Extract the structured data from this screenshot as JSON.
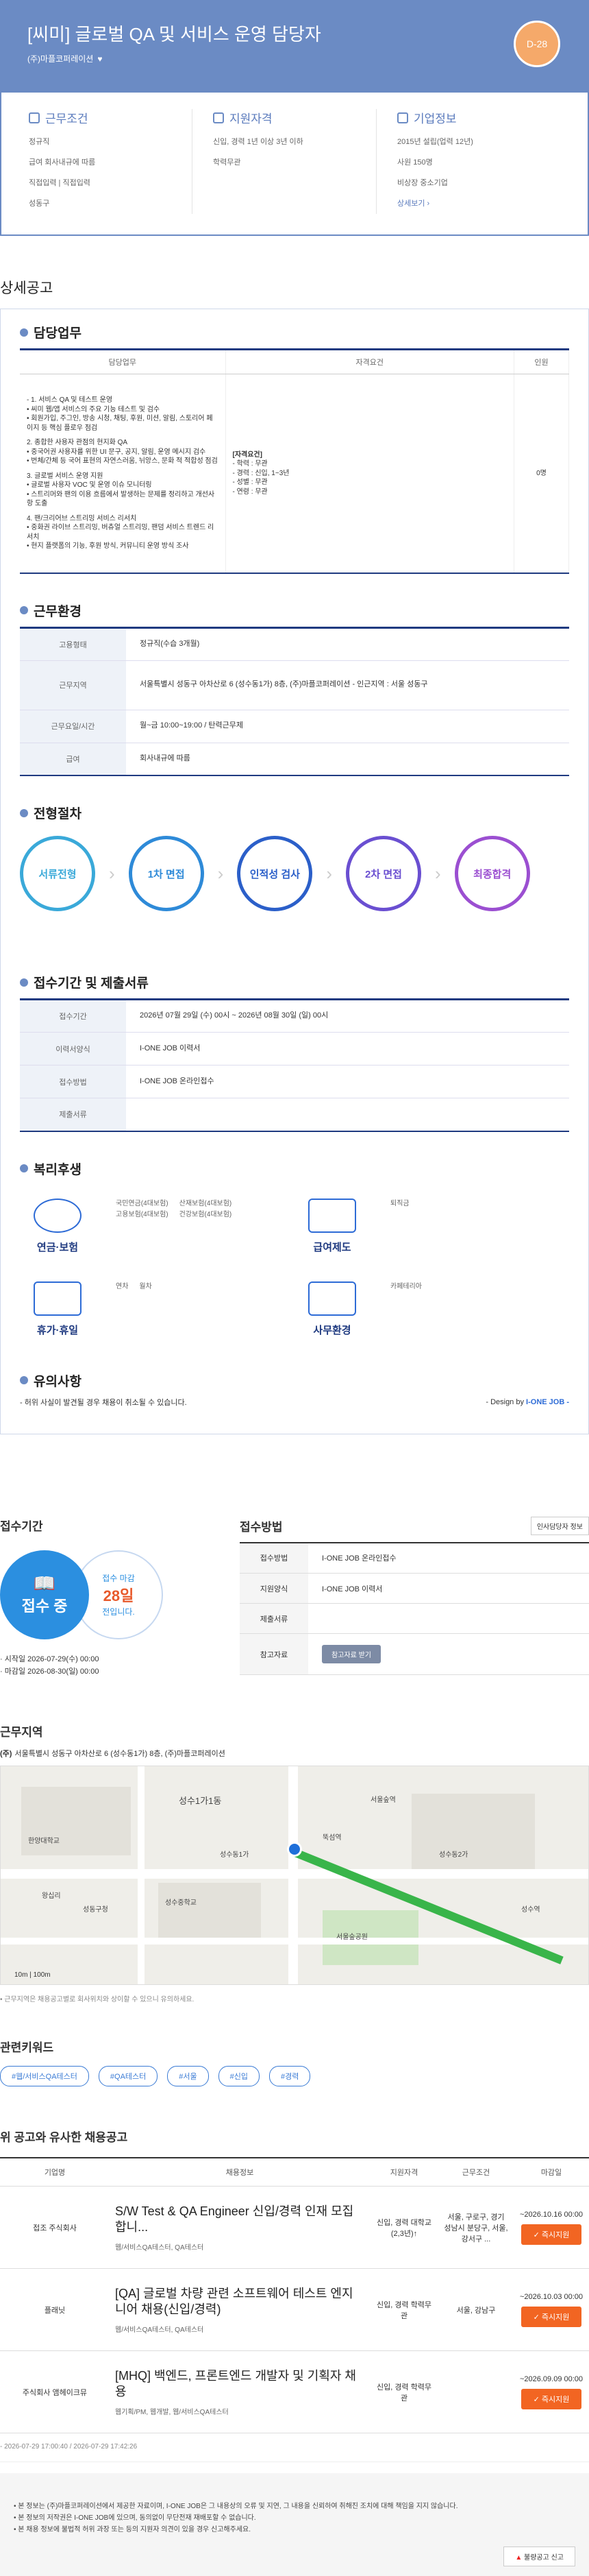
{
  "header": {
    "title": "[씨미] 글로벌 QA 및 서비스 운영 담당자",
    "company": "(주)마플코퍼레이션",
    "dday": "D-28"
  },
  "summary": {
    "conditions": {
      "title": "근무조건",
      "items": [
        "정규직",
        "급여 회사내규에 따름",
        "직접입력 | 직접입력",
        "성동구"
      ]
    },
    "qualification": {
      "title": "지원자격",
      "items": [
        "신입, 경력 1년 이상 3년 이하",
        "학력무관"
      ]
    },
    "company": {
      "title": "기업정보",
      "items": [
        "2015년 설립(업력 12년)",
        "사원 150명",
        "비상장 중소기업"
      ],
      "more": "상세보기"
    }
  },
  "detail": {
    "section_title": "상세공고",
    "duty": {
      "title": "담당업무",
      "headers": [
        "담당업무",
        "자격요건",
        "인원"
      ],
      "duty_text": [
        "- 1. 서비스 QA 및 테스트 운영",
        "• 씨미 웹/앱 서비스의 주요 기능 테스트 및 검수",
        "• 회원가입, 주그인, 방송 시청, 채팅, 후원, 미션, 알림, 스토리어 페이지 등 핵심 플로우 점검",
        "2. 종합한 사용자 관점의 현지화 QA",
        "• 중국어권 사용자를 위한 UI 문구, 공지, 알림, 운영 메시지 검수",
        "• 번체/간체 등 국어 표현의 자연스러움, 뉘앙스, 문화 적 적합성 점검",
        "3. 글로벌 서비스 운영 지원",
        "• 글로벌 사용자 VOC 및 운영 이슈 모니터링",
        "• 스트리머와 팬의 이용 흐름에서 발생하는 문제를 정리하고 개선사항 도출",
        "4. 팬/크리어브 스트리밍 서비스 리서치",
        "• 중화권 라이브 스트리밍, 버츄얼 스트리밍, 팬덤 서비스 트렌드 리서치",
        "• 현지 플랫폼의 기능, 후원 방식, 커뮤니티 운영 방식 조사"
      ],
      "req_text": [
        "[자격요건]",
        "- 학력 : 무관",
        "- 경력 : 신입, 1~3년",
        "- 성별 : 무관",
        "- 연령 : 무관"
      ],
      "count": "0명"
    },
    "env": {
      "title": "근무환경",
      "rows": [
        {
          "k": "고용형태",
          "v": "정규직(수습 3개월)"
        },
        {
          "k": "근무지역",
          "v": "서울특별시 성동구 아차산로 6 (성수동1가) 8층, (주)마플코퍼레이션 - 인근지역 : 서울 성동구"
        },
        {
          "k": "근무요일/시간",
          "v": "월~금 10:00~19:00 / 탄력근무제"
        },
        {
          "k": "급여",
          "v": "회사내규에 따름"
        }
      ]
    },
    "process": {
      "title": "전형절차",
      "steps": [
        {
          "label": "서류전형",
          "color": "#3aa9d9"
        },
        {
          "label": "1차 면접",
          "color": "#2e8ad8"
        },
        {
          "label": "인적성 검사",
          "color": "#2b5fc9"
        },
        {
          "label": "2차 면접",
          "color": "#6a4fd1"
        },
        {
          "label": "최종합격",
          "color": "#9b4fd1"
        }
      ]
    },
    "period": {
      "title": "접수기간 및 제출서류",
      "rows": [
        {
          "k": "접수기간",
          "v": "2026년 07월 29일 (수) 00시 ~ 2026년 08월 30일 (일) 00시"
        },
        {
          "k": "이력서양식",
          "v": "I-ONE JOB 이력서"
        },
        {
          "k": "접수방법",
          "v": "I-ONE JOB 온라인접수"
        },
        {
          "k": "제출서류",
          "v": ""
        }
      ]
    },
    "welfare": {
      "title": "복리후생",
      "groups": [
        {
          "label": "연금·보험",
          "icon": "insurance-icon",
          "items": [
            "국민연금(4대보험)",
            "고용보험(4대보험)",
            "산재보험(4대보험)",
            "건강보험(4대보험)"
          ]
        },
        {
          "label": "급여제도",
          "icon": "salary-icon",
          "items": [
            "퇴직금"
          ]
        },
        {
          "label": "휴가·휴일",
          "icon": "calendar-icon",
          "items": [
            "연차",
            "월차"
          ]
        },
        {
          "label": "사무환경",
          "icon": "office-icon",
          "items": [
            "카페테리아"
          ]
        }
      ]
    },
    "caution": {
      "title": "유의사항",
      "text": "- 허위 사실이 발견될 경우 채용이 취소될 수 있습니다."
    },
    "design_prefix": "- Design by",
    "design_brand": "I-ONE JOB -"
  },
  "apply": {
    "period_title": "접수기간",
    "status": "접수 중",
    "deadline_prefix": "접수 마감",
    "deadline_days": "28일",
    "deadline_suffix": "전입니다.",
    "start": "· 시작일 2026-07-29(수) 00:00",
    "end": "· 마감일 2026-08-30(일) 00:00",
    "method_title": "접수방법",
    "hr_button": "인사담당자 정보",
    "rows": [
      {
        "k": "접수방법",
        "v": "I-ONE JOB 온라인접수"
      },
      {
        "k": "지원양식",
        "v": "I-ONE JOB 이력서"
      },
      {
        "k": "제출서류",
        "v": ""
      },
      {
        "k": "참고자료",
        "v": "참고자료 받기"
      }
    ]
  },
  "location": {
    "title": "근무지역",
    "addr_label": "(주)",
    "addr": "서울특별시 성동구 아차산로 6 (성수동1가) 8층, (주)마플코퍼레이션",
    "note": "• 근무지역은 채용공고별로 회사위치와 상이할 수 있으니 유의하세요.",
    "map_labels": [
      "성수1가1동",
      "성수동1가",
      "서울숲역",
      "뚝섬역",
      "성수역",
      "성수중학교",
      "성동구청",
      "서울숲공원",
      "성수동2가",
      "한양대학교",
      "왕십리",
      "10m",
      "100m"
    ]
  },
  "keywords": {
    "title": "관련키워드",
    "tags": [
      "#웹/서비스QA테스터",
      "#QA테스터",
      "#서울",
      "#신입",
      "#경력"
    ]
  },
  "similar": {
    "title": "위 공고와 유사한 채용공고",
    "headers": [
      "기업명",
      "채용정보",
      "지원자격",
      "근무조건",
      "마감일"
    ],
    "rows": [
      {
        "company": "접조 주식회사",
        "title": "S/W Test & QA Engineer 신입/경력 인재 모집합니...",
        "keywords": "웹/서비스QA테스터, QA테스터",
        "qual": "신입, 경력 대학교(2,3년)↑",
        "cond": "서울, 구로구, 경기 성남시 분당구, 서울, 강서구 ...",
        "deadline": "~2026.10.16 00:00",
        "btn": "즉시지원"
      },
      {
        "company": "플래닛",
        "title": "[QA] 글로벌 차량 관련 소프트웨어 테스트 엔지니어 채용(신입/경력)",
        "keywords": "웹/서비스QA테스터, QA테스터",
        "qual": "신입, 경력 학력무관",
        "cond": "서울, 강남구",
        "deadline": "~2026.10.03 00:00",
        "btn": "즉시지원"
      },
      {
        "company": "주식회사 앰헤이크뮤",
        "title": "[MHQ] 백엔드, 프론트엔드 개발자 및 기획자 채용",
        "keywords": "웹기획/PM, 웹개발, 웹/서비스QA테스터",
        "qual": "신입, 경력 학력무관",
        "cond": "",
        "deadline": "~2026.09.09 00:00",
        "btn": "즉시지원"
      }
    ]
  },
  "timestamps": "- 2026-07-29 17:00:40 / 2026-07-29 17:42:26",
  "footer": {
    "notes": [
      "본 정보는 (주)마플코퍼레이션에서 제공한 자료이며, I-ONE JOB은 그 내용상의 오류 및 지연, 그 내용을 신뢰하여 취해진 조치에 대해 책임을 지지 않습니다.",
      "본 정보의 저작권은 I-ONE JOB에 있으며, 동의없이 무단전재 재배포할 수 없습니다.",
      "본 채용 정보에 불법적 허위 과장 또는 등의 지원자 의견이 있을 경우 신고해주세요."
    ],
    "report": "불량공고 신고"
  }
}
